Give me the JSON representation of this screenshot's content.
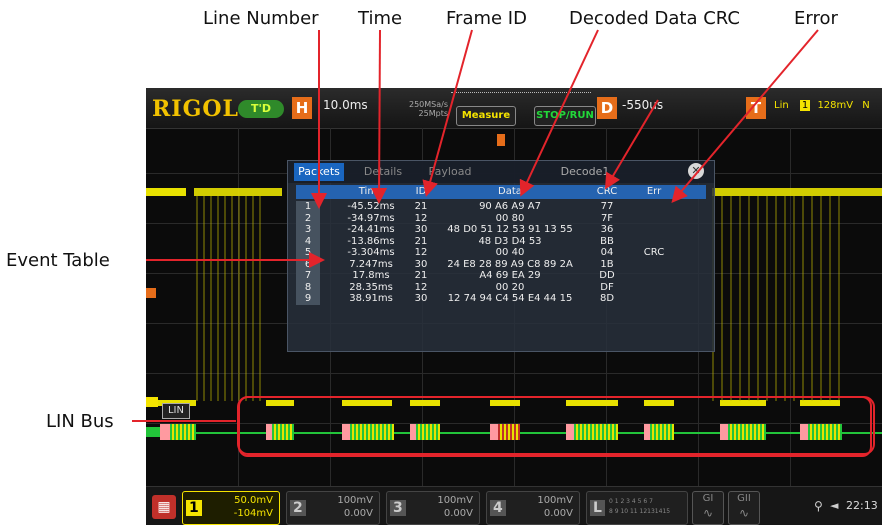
{
  "annotations": {
    "line_number": "Line Number",
    "time": "Time",
    "frame_id": "Frame ID",
    "decoded_data_crc": "Decoded Data CRC",
    "error": "Error",
    "event_table": "Event  Table",
    "lin_bus": "LIN Bus"
  },
  "scope": {
    "brand": "RIGOL",
    "mode_badge": "T'D",
    "horizontal": {
      "label": "H",
      "timebase": "10.0ms",
      "sample_rate": "250MSa/s",
      "memory_depth": "25Mpts"
    },
    "buttons": {
      "measure": "Measure",
      "stop_run": "STOP/RUN"
    },
    "delay": {
      "label": "D",
      "value": "-550us"
    },
    "trigger": {
      "label": "T",
      "type": "Lin",
      "source": "1",
      "level": "128mV",
      "suffix": "N"
    },
    "bus_label": "LIN",
    "decode_table": {
      "tabs": [
        "Packets",
        "Details",
        "Payload",
        "Decode1"
      ],
      "columns": [
        "",
        "Time",
        "ID",
        "Data",
        "CRC",
        "Err"
      ],
      "rows": [
        {
          "n": "1",
          "time": "-45.52ms",
          "id": "21",
          "data": "90 A6 A9 A7",
          "crc": "77",
          "err": ""
        },
        {
          "n": "2",
          "time": "-34.97ms",
          "id": "12",
          "data": "00 80",
          "crc": "7F",
          "err": ""
        },
        {
          "n": "3",
          "time": "-24.41ms",
          "id": "30",
          "data": "48 D0 51 12 53 91 13 55",
          "crc": "36",
          "err": ""
        },
        {
          "n": "4",
          "time": "-13.86ms",
          "id": "21",
          "data": "48 D3 D4 53",
          "crc": "BB",
          "err": ""
        },
        {
          "n": "5",
          "time": "-3.304ms",
          "id": "12",
          "data": "00 40",
          "crc": "04",
          "err": "CRC"
        },
        {
          "n": "6",
          "time": "7.247ms",
          "id": "30",
          "data": "24 E8 28 89 A9 C8 89 2A",
          "crc": "1B",
          "err": ""
        },
        {
          "n": "7",
          "time": "17.8ms",
          "id": "21",
          "data": "A4 69 EA 29",
          "crc": "DD",
          "err": ""
        },
        {
          "n": "8",
          "time": "28.35ms",
          "id": "12",
          "data": "00 20",
          "crc": "DF",
          "err": ""
        },
        {
          "n": "9",
          "time": "38.91ms",
          "id": "30",
          "data": "12 74 94 C4 54 E4 44 15",
          "crc": "8D",
          "err": ""
        }
      ]
    },
    "channels": [
      {
        "num": "1",
        "v1": "50.0mV",
        "v2": "-104mV"
      },
      {
        "num": "2",
        "v1": "100mV",
        "v2": "0.00V"
      },
      {
        "num": "3",
        "v1": "100mV",
        "v2": "0.00V"
      },
      {
        "num": "4",
        "v1": "100mV",
        "v2": "0.00V"
      }
    ],
    "logic": {
      "label": "L",
      "bits_top": "0 1 2 3  4 5 6 7",
      "bits_bottom": "8 9 10 11 12131415"
    },
    "bus_buttons": [
      "GI",
      "GII"
    ],
    "clock": "22:13",
    "colors": {
      "ch1": "#f5e400",
      "ch2": "#26d0ff",
      "ch3": "#ff40ff",
      "ch4": "#2b7cff",
      "bus": "#22c43a",
      "accent": "#e66d1a"
    }
  }
}
